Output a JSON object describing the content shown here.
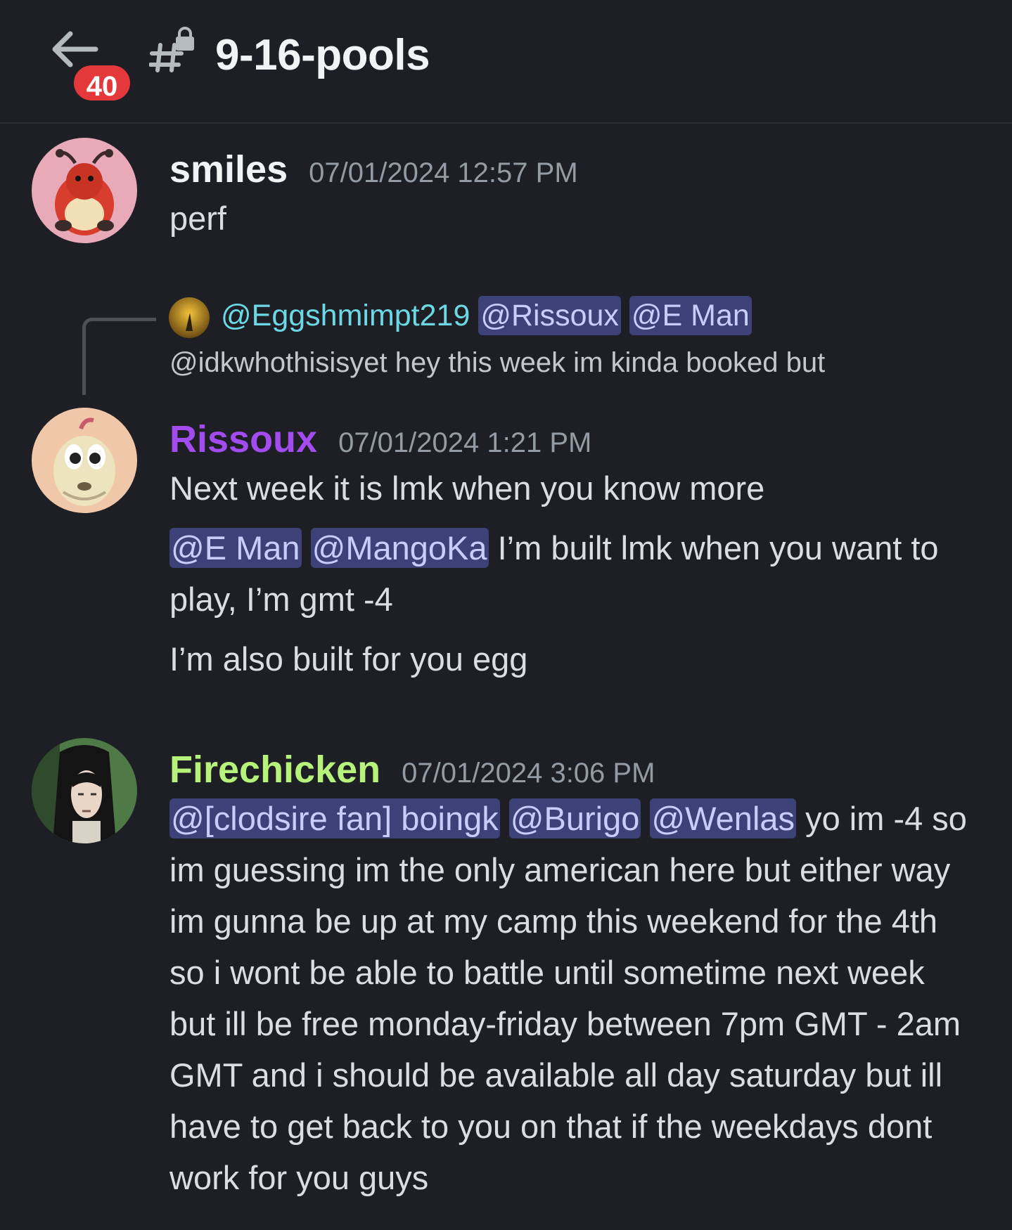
{
  "header": {
    "badge_count": "40",
    "channel_name": "9-16-pools"
  },
  "messages": [
    {
      "author": "smiles",
      "timestamp": "07/01/2024 12:57 PM",
      "lines": [
        "perf"
      ]
    },
    {
      "reply": {
        "author": "@Eggshmimpt219",
        "mentions": [
          "@Rissoux",
          "@E Man"
        ],
        "text": "@idkwhothisisyet hey this week im kinda booked but"
      },
      "author": "Rissoux",
      "timestamp": "07/01/2024 1:21 PM",
      "line1": "Next week it is lmk when you know more",
      "line2_mentions": [
        "@E Man",
        "@MangoKa"
      ],
      "line2_text": " I’m built lmk when you want to play, I’m gmt -4",
      "line3": "I’m also built for you egg"
    },
    {
      "author": "Firechicken",
      "timestamp": "07/01/2024 3:06 PM",
      "mentions": [
        "@[clodsire fan] boingk",
        "@Burigo",
        "@Wenlas"
      ],
      "text": " yo im -4 so im guessing im the only american here but either way im gunna be up at my camp this weekend for the 4th so i wont be able to battle until sometime next week but ill be free monday-friday between 7pm GMT - 2am GMT and i should be available all day saturday but ill have to get back to you on that if the weekdays dont work for you guys"
    }
  ],
  "colors": {
    "background": "#1e1f24",
    "badge": "#e5383b",
    "mention_bg": "#3c4178",
    "mention_text": "#c9cdfb",
    "rissoux": "#a24cf0",
    "firechicken": "#b7f27a",
    "reply_author": "#6cd8e6"
  }
}
